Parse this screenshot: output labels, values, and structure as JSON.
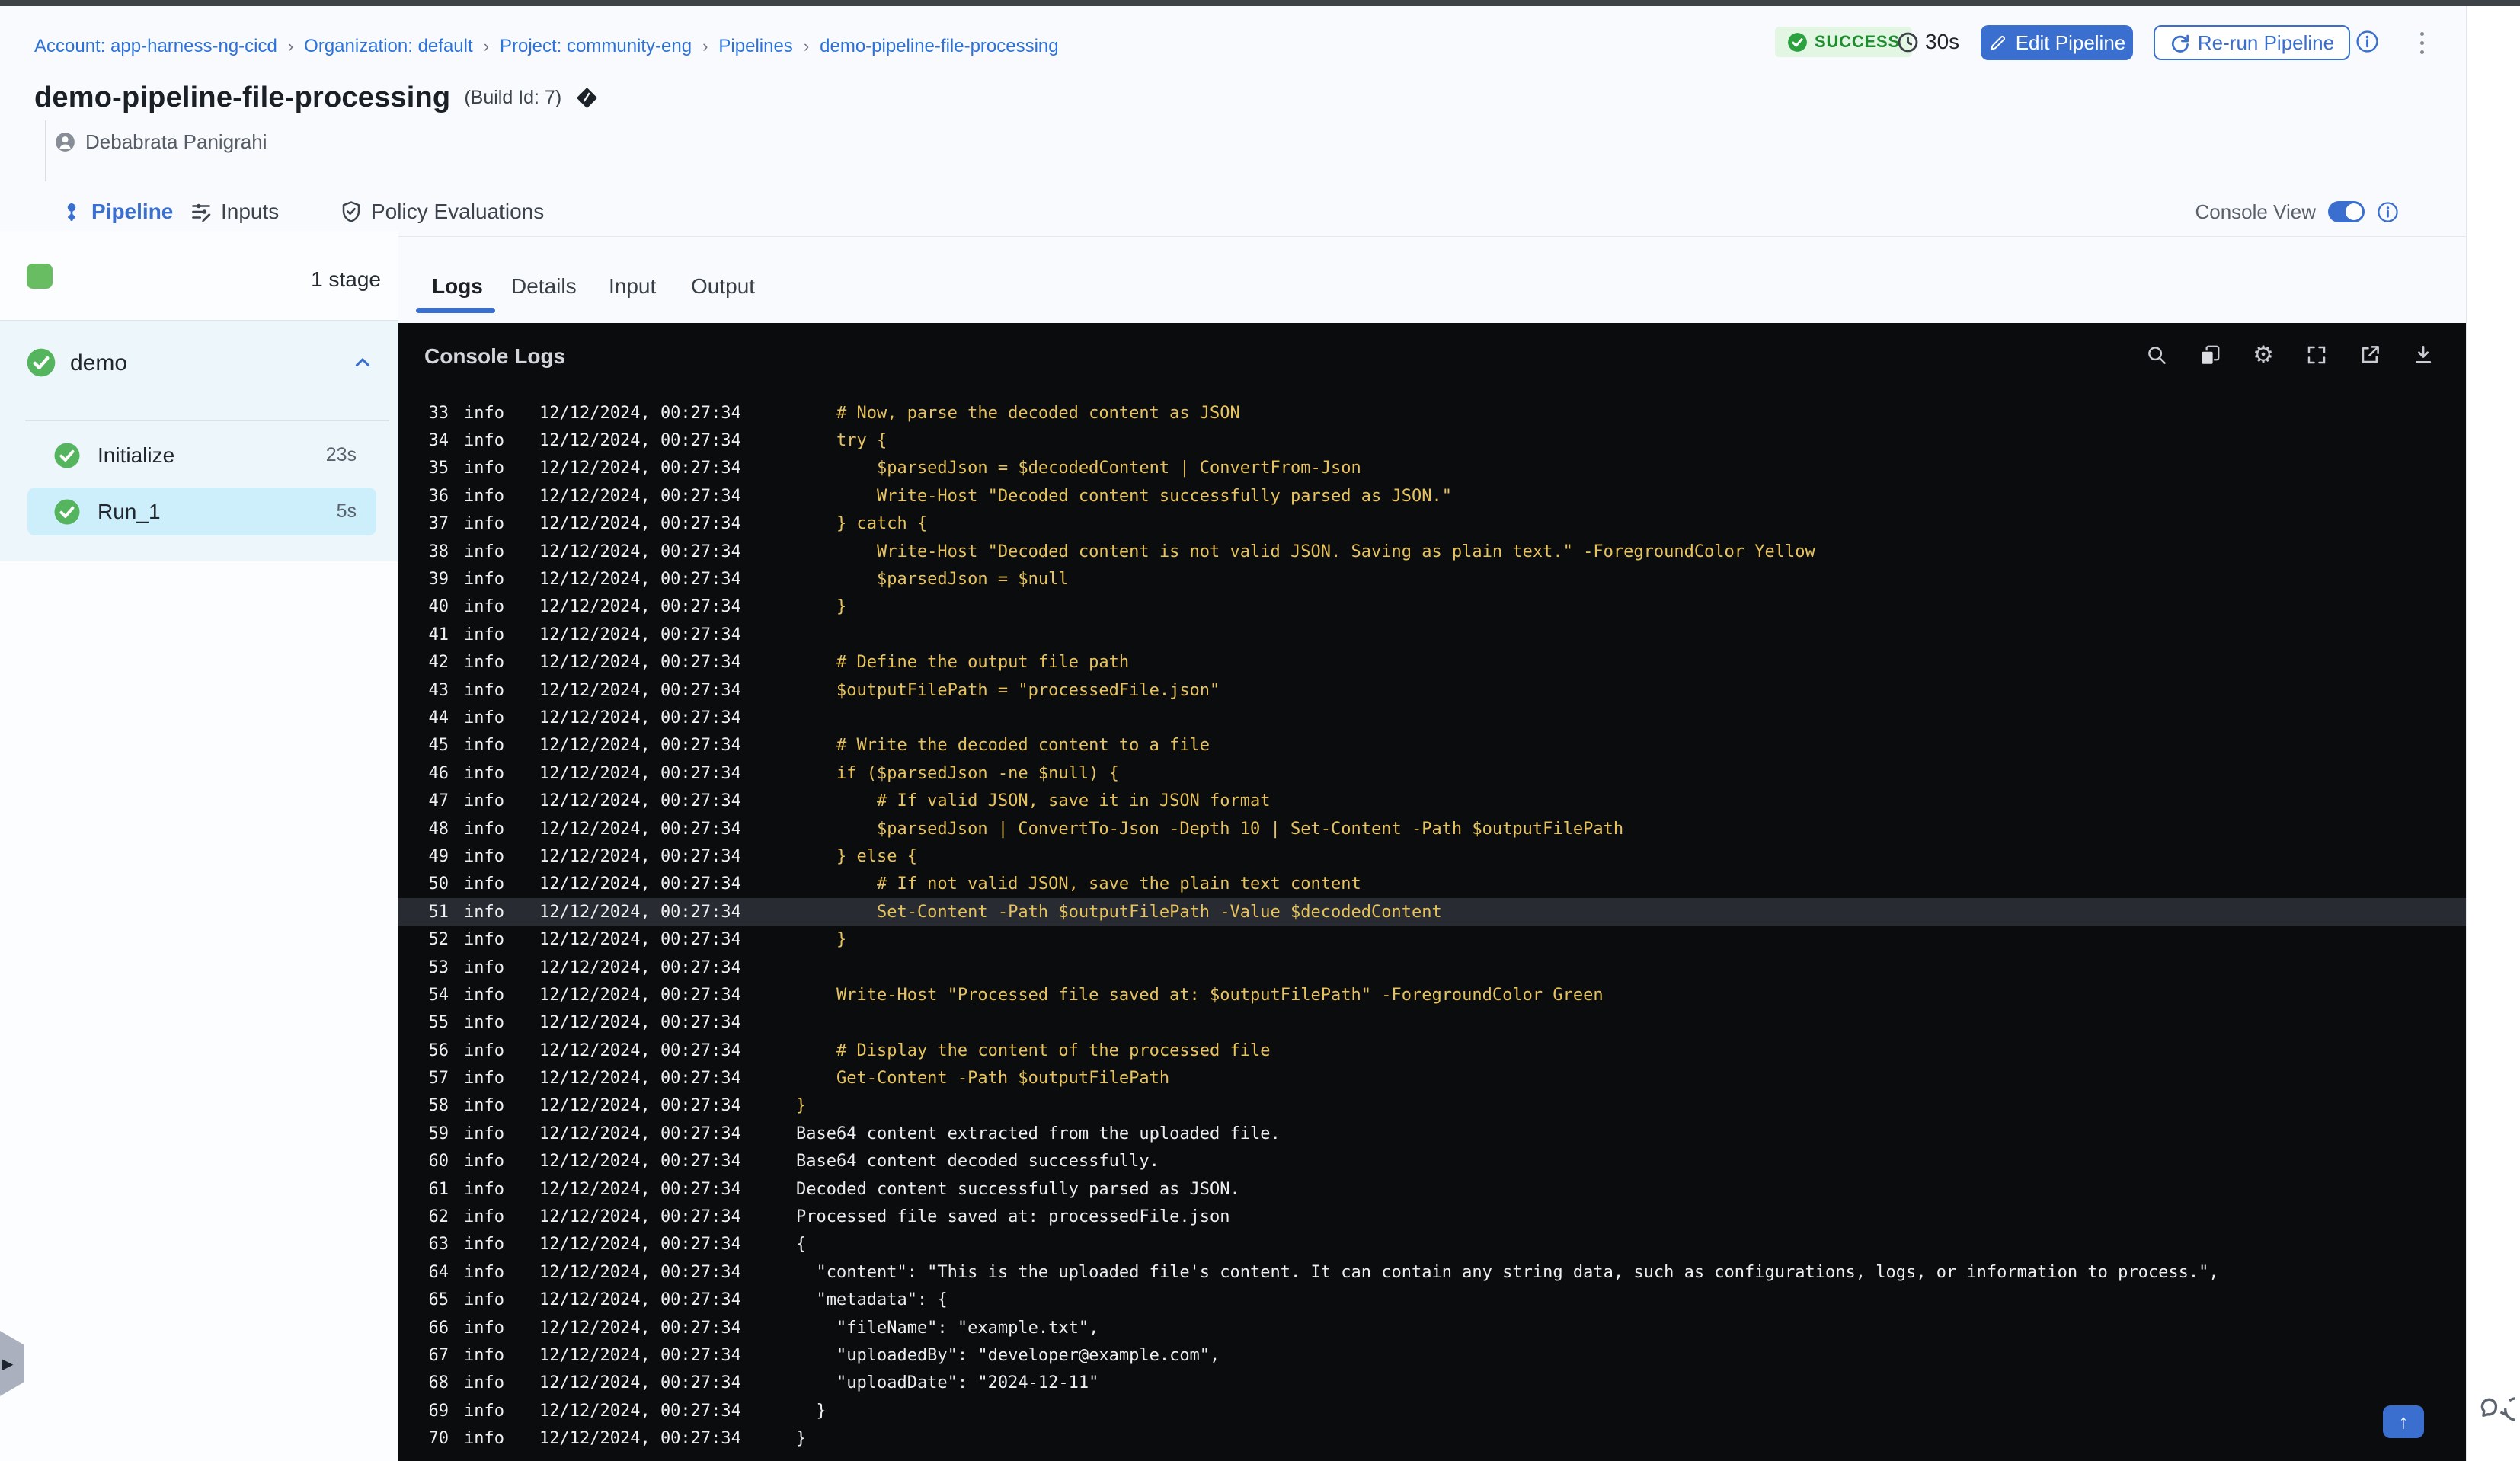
{
  "colors": {
    "accent": "#3a6fd0",
    "link": "#2d72d9",
    "topbar": "#3e4347",
    "success_bg": "#e2f6e3",
    "success_fg": "#1f8c30",
    "sidebar_selected": "#cdeefb",
    "console_bg": "#0b0c0e",
    "script_text": "#e7c35e",
    "output_text": "#eceef0",
    "meta_text": "#eef0f2",
    "highlight_row": "#282b31"
  },
  "breadcrumb": {
    "separator": "›",
    "items": [
      "Account: app-harness-ng-cicd",
      "Organization: default",
      "Project: community-eng",
      "Pipelines",
      "demo-pipeline-file-processing"
    ]
  },
  "run_status": {
    "label": "SUCCESS",
    "duration": "30s"
  },
  "header": {
    "title": "demo-pipeline-file-processing",
    "build_id": "(Build Id: 7)",
    "user": "Debabrata Panigrahi",
    "edit_button": "Edit Pipeline",
    "rerun_button": "Re-run Pipeline"
  },
  "nav_tabs": {
    "items": [
      "Pipeline",
      "Inputs",
      "Policy Evaluations"
    ],
    "active": "Pipeline",
    "console_view_label": "Console View",
    "console_view_on": true
  },
  "stage_panel": {
    "stage_count": "1 stage",
    "group_label": "demo",
    "steps": [
      {
        "label": "Initialize",
        "duration": "23s",
        "selected": false
      },
      {
        "label": "Run_1",
        "duration": "5s",
        "selected": true
      }
    ]
  },
  "log_panel": {
    "tabs": [
      "Logs",
      "Details",
      "Input",
      "Output"
    ],
    "active_tab": "Logs",
    "console_title": "Console Logs"
  },
  "icons": [
    "pipeline-icon",
    "inputs-icon",
    "policy-shield-icon",
    "user-avatar-icon",
    "build-diamond-icon",
    "clock-icon",
    "edit-pencil-icon",
    "rerun-refresh-icon",
    "info-icon",
    "kebab-menu-icon",
    "console-view-toggle",
    "search-icon",
    "copy-icon",
    "settings-gear-icon",
    "fullscreen-icon",
    "open-in-new-icon",
    "download-icon",
    "check-circle-icon",
    "chevron-up-icon",
    "scroll-to-top-icon",
    "chat-support-icon",
    "panel-expand-icon"
  ],
  "log": {
    "level": "info",
    "timestamp": "12/12/2024, 00:27:34",
    "lines": [
      {
        "n": 33,
        "type": "script",
        "msg": "    # Now, parse the decoded content as JSON"
      },
      {
        "n": 34,
        "type": "script",
        "msg": "    try {"
      },
      {
        "n": 35,
        "type": "script",
        "msg": "        $parsedJson = $decodedContent | ConvertFrom-Json"
      },
      {
        "n": 36,
        "type": "script",
        "msg": "        Write-Host \"Decoded content successfully parsed as JSON.\""
      },
      {
        "n": 37,
        "type": "script",
        "msg": "    } catch {"
      },
      {
        "n": 38,
        "type": "script",
        "msg": "        Write-Host \"Decoded content is not valid JSON. Saving as plain text.\" -ForegroundColor Yellow"
      },
      {
        "n": 39,
        "type": "script",
        "msg": "        $parsedJson = $null"
      },
      {
        "n": 40,
        "type": "script",
        "msg": "    }"
      },
      {
        "n": 41,
        "type": "script",
        "msg": ""
      },
      {
        "n": 42,
        "type": "script",
        "msg": "    # Define the output file path"
      },
      {
        "n": 43,
        "type": "script",
        "msg": "    $outputFilePath = \"processedFile.json\""
      },
      {
        "n": 44,
        "type": "script",
        "msg": ""
      },
      {
        "n": 45,
        "type": "script",
        "msg": "    # Write the decoded content to a file"
      },
      {
        "n": 46,
        "type": "script",
        "msg": "    if ($parsedJson -ne $null) {"
      },
      {
        "n": 47,
        "type": "script",
        "msg": "        # If valid JSON, save it in JSON format"
      },
      {
        "n": 48,
        "type": "script",
        "msg": "        $parsedJson | ConvertTo-Json -Depth 10 | Set-Content -Path $outputFilePath"
      },
      {
        "n": 49,
        "type": "script",
        "msg": "    } else {"
      },
      {
        "n": 50,
        "type": "script",
        "msg": "        # If not valid JSON, save the plain text content"
      },
      {
        "n": 51,
        "type": "script",
        "msg": "        Set-Content -Path $outputFilePath -Value $decodedContent",
        "highlight": true
      },
      {
        "n": 52,
        "type": "script",
        "msg": "    }"
      },
      {
        "n": 53,
        "type": "script",
        "msg": ""
      },
      {
        "n": 54,
        "type": "script",
        "msg": "    Write-Host \"Processed file saved at: $outputFilePath\" -ForegroundColor Green"
      },
      {
        "n": 55,
        "type": "script",
        "msg": ""
      },
      {
        "n": 56,
        "type": "script",
        "msg": "    # Display the content of the processed file"
      },
      {
        "n": 57,
        "type": "script",
        "msg": "    Get-Content -Path $outputFilePath"
      },
      {
        "n": 58,
        "type": "script",
        "msg": "}"
      },
      {
        "n": 59,
        "type": "output",
        "msg": "Base64 content extracted from the uploaded file."
      },
      {
        "n": 60,
        "type": "output",
        "msg": "Base64 content decoded successfully."
      },
      {
        "n": 61,
        "type": "output",
        "msg": "Decoded content successfully parsed as JSON."
      },
      {
        "n": 62,
        "type": "output",
        "msg": "Processed file saved at: processedFile.json"
      },
      {
        "n": 63,
        "type": "output",
        "msg": "{"
      },
      {
        "n": 64,
        "type": "output",
        "msg": "  \"content\": \"This is the uploaded file's content. It can contain any string data, such as configurations, logs, or information to process.\","
      },
      {
        "n": 65,
        "type": "output",
        "msg": "  \"metadata\": {"
      },
      {
        "n": 66,
        "type": "output",
        "msg": "    \"fileName\": \"example.txt\","
      },
      {
        "n": 67,
        "type": "output",
        "msg": "    \"uploadedBy\": \"developer@example.com\","
      },
      {
        "n": 68,
        "type": "output",
        "msg": "    \"uploadDate\": \"2024-12-11\""
      },
      {
        "n": 69,
        "type": "output",
        "msg": "  }"
      },
      {
        "n": 70,
        "type": "output",
        "msg": "}"
      }
    ]
  }
}
